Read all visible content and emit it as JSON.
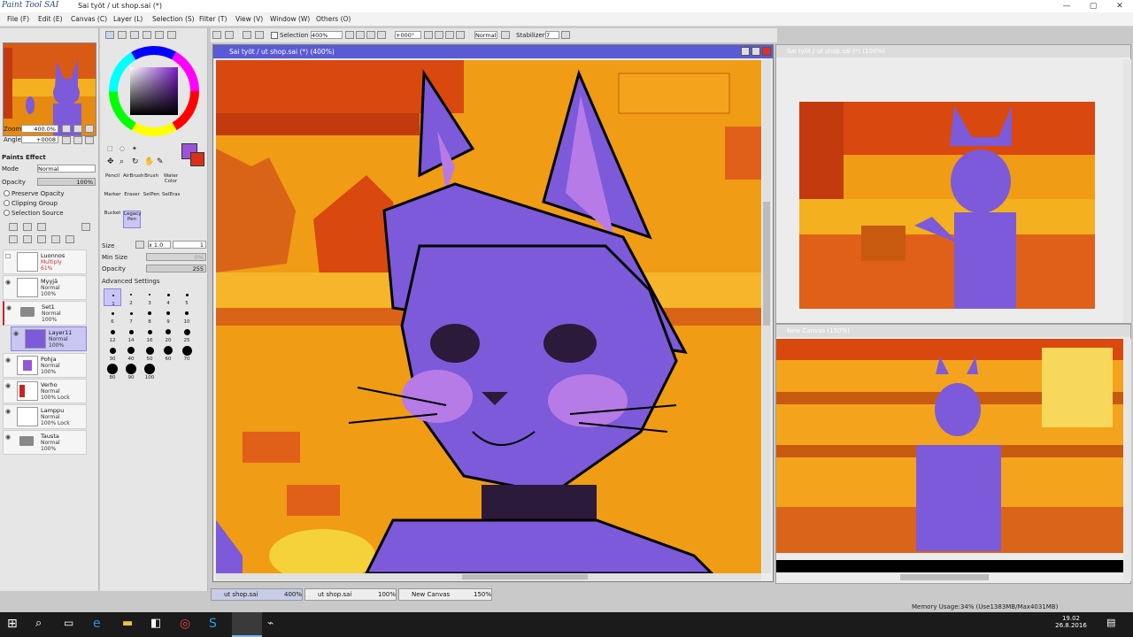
{
  "app": {
    "logo": "Paint Tool SAI",
    "title": "Sai työt / ut shop.sai (*)"
  },
  "menu": [
    "File (F)",
    "Edit (E)",
    "Canvas (C)",
    "Layer (L)",
    "Selection (S)",
    "Filter (T)",
    "View (V)",
    "Window (W)",
    "Others (O)"
  ],
  "toolbar": {
    "selection_label": "Selection",
    "zoom": "400%",
    "rotation": "+000°",
    "mode": "Normal",
    "stabilizer_label": "Stabilizer",
    "stabilizer_value": "7"
  },
  "navigator": {
    "zoom_label": "Zoom",
    "zoom_value": "400.0%",
    "angle_label": "Angle",
    "angle_value": "+0008"
  },
  "layer_props": {
    "paints_effect": "Paints Effect",
    "mode_label": "Mode",
    "mode_value": "Normal",
    "opacity_label": "Opacity",
    "opacity_value": "100%",
    "preserve_opacity": "Preserve Opacity",
    "clipping_group": "Clipping Group",
    "selection_source": "Selection Source"
  },
  "layers": [
    {
      "name": "Luonnos",
      "mode": "Multiply",
      "opacity": "61%"
    },
    {
      "name": "Myyjä",
      "mode": "Normal",
      "opacity": "100%"
    },
    {
      "name": "Set1",
      "mode": "Normal",
      "opacity": "100%"
    },
    {
      "name": "Layer11",
      "mode": "Normal",
      "opacity": "100%"
    },
    {
      "name": "Pohja",
      "mode": "Normal",
      "opacity": "100%"
    },
    {
      "name": "Verho",
      "mode": "Normal",
      "opacity": "100% Lock"
    },
    {
      "name": "Lamppu",
      "mode": "Normal",
      "opacity": "100% Lock"
    },
    {
      "name": "Tausta",
      "mode": "Normal",
      "opacity": "100%"
    }
  ],
  "tools": [
    "Pencil",
    "AirBrush",
    "Brush",
    "Water Color",
    "Marker",
    "Eraser",
    "SelPen",
    "SelEras",
    "Bucket",
    "Legacy Pen"
  ],
  "brush_settings": {
    "size_label": "Size",
    "size_mult": "x 1.0",
    "size_value": "1",
    "min_size_label": "Min Size",
    "min_size_value": "0%",
    "opacity_label": "Opacity",
    "opacity_value": "255",
    "advanced": "Advanced Settings"
  },
  "brush_sizes": [
    "1",
    "2",
    "3",
    "4",
    "5",
    "6",
    "7",
    "8",
    "9",
    "10",
    "12",
    "14",
    "16",
    "20",
    "25",
    "30",
    "40",
    "50",
    "60",
    "70",
    "80",
    "90",
    "100"
  ],
  "windows": {
    "main_title": "Sai työt / ut shop.sai (*) (400%)",
    "right_top_title": "Sai työt / ut shop.sai (*) (100%)",
    "right_bottom_title": "New Canvas (150%)"
  },
  "tabs": [
    {
      "name": "ut shop.sai",
      "zoom": "400%"
    },
    {
      "name": "ut shop.sai",
      "zoom": "100%"
    },
    {
      "name": "New Canvas",
      "zoom": "150%"
    }
  ],
  "status": {
    "memory": "Memory Usage:34% (Use1383MB/Max4031MB)",
    "time": "19.02",
    "date": "26.8.2016"
  },
  "colors": {
    "accent": "#5a5ad6",
    "primary_color": "#9a55d6",
    "secondary_color": "#d9301a",
    "canvas_orange": "#f09c14"
  }
}
